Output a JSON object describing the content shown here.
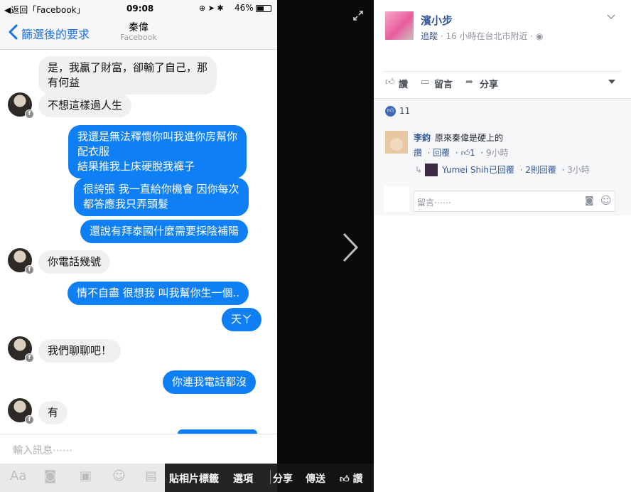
{
  "status_bar": {
    "back_app": "◀返回「Facebook」",
    "time": "09:08",
    "battery": "46%"
  },
  "nav": {
    "back_label": "篩選後的要求",
    "contact_name": "秦偉",
    "contact_source": "Facebook"
  },
  "messages": [
    {
      "dir": "in",
      "text": "是，我贏了財富，卻輸了自己，那\n有何益"
    },
    {
      "dir": "in",
      "text": "不想這樣過人生"
    },
    {
      "dir": "out",
      "text": "我還是無法釋懷你叫我進你房幫你\n配衣服\n結果推我上床硬脫我褲子"
    },
    {
      "dir": "out",
      "text": "很誇張 我一直給你機會 因你每次\n都答應我只弄頭髮"
    },
    {
      "dir": "out",
      "text": "還說有拜泰國什麼需要採陰補陽"
    },
    {
      "dir": "in",
      "text": "你電話幾號"
    },
    {
      "dir": "out",
      "text": "情不自盡 很想我 叫我幫你生一個.."
    },
    {
      "dir": "out",
      "text": "天ㄚ"
    },
    {
      "dir": "in",
      "text": "我們聊聊吧！"
    },
    {
      "dir": "out",
      "text": "你連我電話都沒"
    },
    {
      "dir": "in",
      "text": "有"
    }
  ],
  "composer": {
    "placeholder": "輸入訊息⋯⋯"
  },
  "viewer_actions": {
    "tag": "貼相片標籤",
    "options": "選項",
    "share": "分享",
    "send": "傳送",
    "like": "讚"
  },
  "post": {
    "author": "濱小步",
    "follow": "追蹤",
    "meta": " · 16 小時在台北市附近 · ",
    "actions": {
      "like": "讚",
      "comment": "留言",
      "share": "分享"
    },
    "like_count": "11",
    "comment": {
      "author": "李鈞",
      "text": "原來秦偉是硬上的",
      "like": "讚",
      "reply": "回覆",
      "likes": "1",
      "time": "9小時"
    },
    "reply_summary": {
      "who": "Yumei Shih已回覆",
      "count": "2則回覆",
      "time": "3小時"
    },
    "comment_placeholder": "留言⋯⋯"
  }
}
